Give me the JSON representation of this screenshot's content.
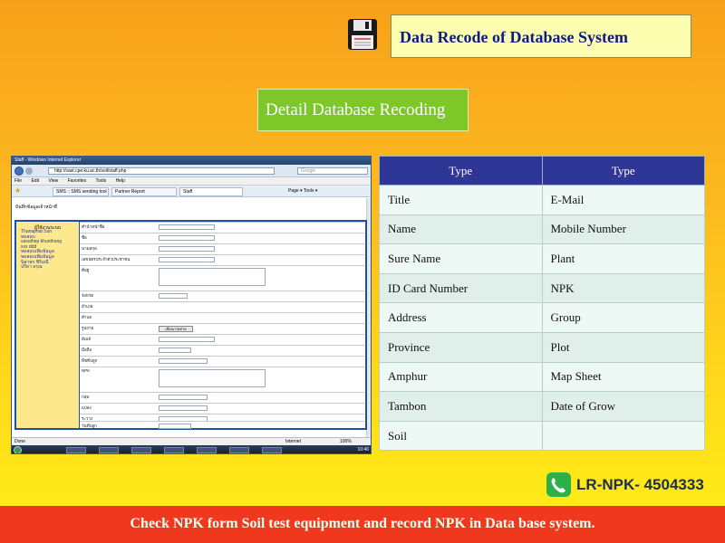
{
  "header": {
    "title": "Data Recode of Database System",
    "subtitle": "Detail Database Recoding",
    "icon": "floppy-disk-icon"
  },
  "browser": {
    "window_title": "Staff - Windows Internet Explorer",
    "url": "http://vast.cpe.ku.ac.th/soil/staff.php",
    "search_placeholder": "Google",
    "menu": [
      "File",
      "Edit",
      "View",
      "Favorites",
      "Tools",
      "Help"
    ],
    "tabs": [
      "SMS :: SMS sending tool",
      "Partner Report",
      "Staff"
    ],
    "toolbar": "Page ▾  Tools ▾",
    "page_heading": "บันทึกข้อมูลเจ้าหน้าที่",
    "sidebar_title": "ผู้ใช้งานระบบ",
    "sidebar_items": [
      "Thanaphat Sun",
      "ทดสอบ",
      "vasuthep khunthong",
      "xxx ddd",
      "ทดสอบเพิ่มข้อมูล",
      "ทดสอบเพิ่มข้อมูล",
      "นิสาพร ชิริมณี",
      "ปรีดา อรุณ"
    ],
    "form_labels": [
      "คำนำหน้าชื่อ",
      "ชื่อ",
      "นามสกุล",
      "เลขบัตรประจำตัวประชาชน",
      "ที่อยู่",
      "จังหวัด",
      "อำเภอ",
      "ตำบล",
      "รูปถ่าย",
      "อีเมล์",
      "มือถือ",
      "พืชที่ปลูก",
      "NPK",
      "กลุ่ม",
      "แปลง",
      "ระวาง",
      "วันที่ปลูก"
    ],
    "upload_button": "เลือกภาพถ่าย",
    "status_done": "Done",
    "status_zone": "Internet",
    "status_zoom": "100%",
    "clock": "10:46"
  },
  "table": {
    "headers": [
      "Type",
      "Type"
    ],
    "rows": [
      [
        "Title",
        "E-Mail"
      ],
      [
        "Name",
        "Mobile Number"
      ],
      [
        "Sure Name",
        "Plant"
      ],
      [
        "ID Card Number",
        "NPK"
      ],
      [
        "Address",
        "Group"
      ],
      [
        "Province",
        "Plot"
      ],
      [
        "Amphur",
        "Map Sheet"
      ],
      [
        "Tambon",
        "Date of Grow"
      ],
      [
        "Soil",
        ""
      ]
    ]
  },
  "contact": {
    "icon": "phone-icon",
    "label": "LR-NPK- 4504333"
  },
  "footer": {
    "text": "Check NPK form Soil test equipment and record NPK in Data base system."
  },
  "colors": {
    "table_header": "#2e3796",
    "footer": "#f0381e",
    "subtitle_box": "#7dc828",
    "title_box": "#fdfdb0",
    "title_text": "#0d1a8a"
  }
}
